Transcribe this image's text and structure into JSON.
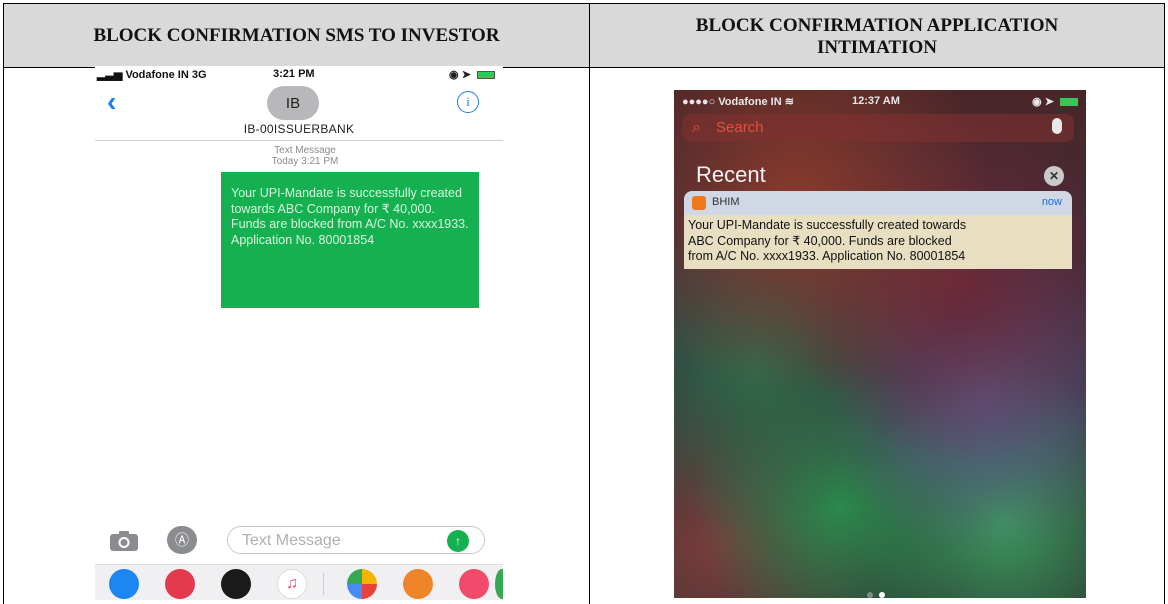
{
  "table": {
    "left_header": "BLOCK CONFIRMATION SMS TO INVESTOR",
    "right_header_line1": "BLOCK CONFIRMATION APPLICATION",
    "right_header_line2": "INTIMATION"
  },
  "sms_screen": {
    "status": {
      "carrier": "Vodafone IN  3G",
      "time": "3:21 PM"
    },
    "avatar_initials": "IB",
    "contact_name": "IB-00ISSUERBANK",
    "info_glyph": "i",
    "meta_line1": "Text Message",
    "meta_line2": "Today 3:21 PM",
    "message": "Your UPI-Mandate is successfully created towards ABC Company for ₹ 40,000. Funds are blocked from A/C No. xxxx1933. Application No. 80001854",
    "compose_placeholder": "Text Message",
    "bubble_color": "#15b150",
    "accent_color": "#1a7cf5"
  },
  "lock_screen": {
    "status": {
      "carrier": "Vodafone IN",
      "time": "12:37 AM"
    },
    "search_placeholder": "Search",
    "recent_label": "Recent",
    "notification": {
      "app_name": "BHIM",
      "time": "now",
      "line1": "Your UPI-Mandate is successfully created towards",
      "line2": "ABC Company for ₹ 40,000. Funds are blocked",
      "line3": "from A/C No. xxxx1933. Application No. 80001854"
    }
  },
  "icons": {
    "back": "chevron-left-icon",
    "info": "info-icon",
    "camera": "camera-icon",
    "appstore": "app-store-icon",
    "send": "send-arrow-icon",
    "search": "search-icon",
    "mic": "microphone-icon",
    "clear": "clear-x-icon",
    "bhim": "bhim-app-icon"
  }
}
